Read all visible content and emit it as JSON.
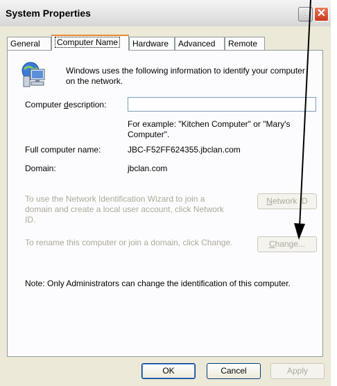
{
  "window": {
    "title": "System Properties",
    "help_label": "?",
    "close_label": "✕"
  },
  "tabs": [
    {
      "label": "General"
    },
    {
      "label": "Computer Name"
    },
    {
      "label": "Hardware"
    },
    {
      "label": "Advanced"
    },
    {
      "label": "Remote"
    }
  ],
  "info_line1": "Windows uses the following information to identify your computer",
  "info_line2": "on the network.",
  "description": {
    "label_pre": "Computer ",
    "label_u": "d",
    "label_post": "escription:",
    "value": "",
    "example_line1": "For example: \"Kitchen Computer\" or \"Mary's",
    "example_line2": "Computer\"."
  },
  "full_name": {
    "label": "Full computer name:",
    "value": "JBC-F52FF624355.jbclan.com"
  },
  "domain": {
    "label": "Domain:",
    "value": "jbclan.com"
  },
  "netid": {
    "text1": "To use the Network Identification Wizard to join a",
    "text2": "domain and create a local user account, click Network",
    "text3": "ID.",
    "button_u": "N",
    "button_rest": "etwork ID"
  },
  "rename": {
    "text": "To rename this computer or join a domain, click Change.",
    "button_u": "C",
    "button_rest": "hange..."
  },
  "note": "Note: Only Administrators can change the identification of this computer.",
  "footer": {
    "ok": "OK",
    "cancel": "Cancel",
    "apply": "Apply"
  },
  "icons": {
    "computer": "computer-network-icon",
    "annotation": "annotation-arrow"
  }
}
